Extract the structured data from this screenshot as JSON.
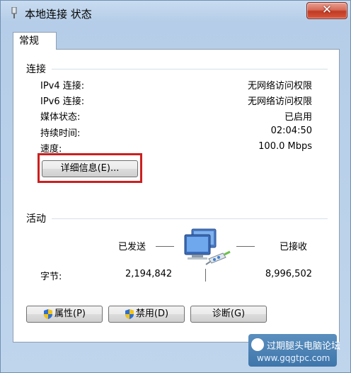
{
  "window": {
    "title": "本地连接 状态",
    "close_label": "✕"
  },
  "tabs": [
    {
      "label": "常规"
    }
  ],
  "connection": {
    "heading": "连接",
    "rows": [
      {
        "label": "IPv4 连接:",
        "value": "无网络访问权限"
      },
      {
        "label": "IPv6 连接:",
        "value": "无网络访问权限"
      },
      {
        "label": "媒体状态:",
        "value": "已启用"
      },
      {
        "label": "持续时间:",
        "value": "02:04:50"
      },
      {
        "label": "速度:",
        "value": "100.0 Mbps"
      }
    ],
    "details_button": "详细信息(E)..."
  },
  "activity": {
    "heading": "活动",
    "sent_label": "已发送",
    "received_label": "已接收",
    "bytes_label": "字节:",
    "bytes_sent": "2,194,842",
    "bytes_received": "8,996,502"
  },
  "buttons": {
    "properties": "属性(P)",
    "disable": "禁用(D)",
    "diagnose": "诊断(G)"
  },
  "watermark": {
    "line1": "过期腿头电脑论坛",
    "line2": "www.gqgtpc.com"
  },
  "colors": {
    "highlight": "#cc1f1f",
    "close_button": "#c03a22"
  }
}
